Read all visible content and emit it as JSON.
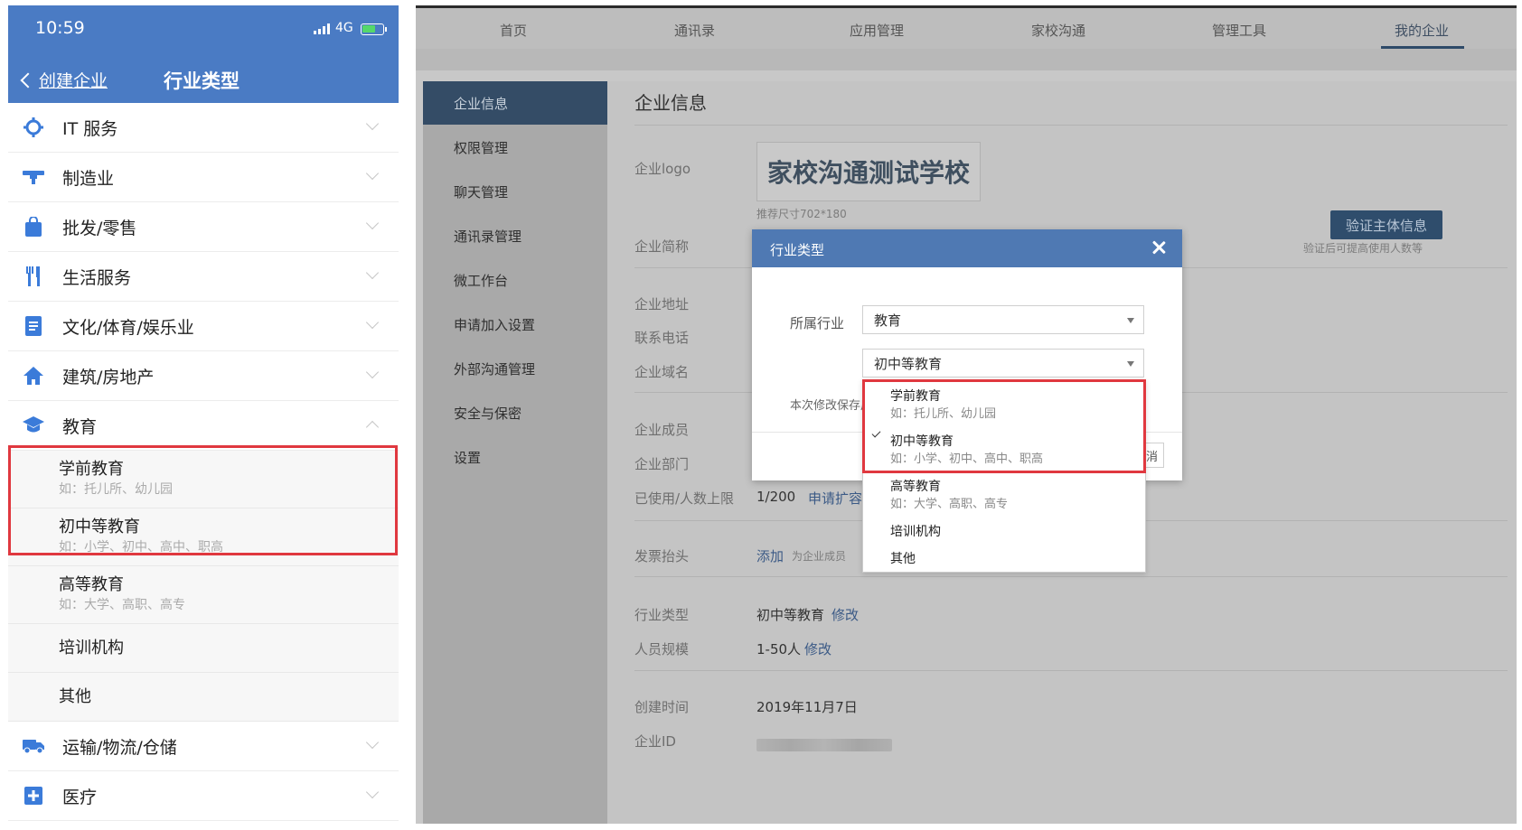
{
  "mobile": {
    "status": {
      "time": "10:59",
      "network": "4G"
    },
    "nav": {
      "back_label": "创建企业",
      "title": "行业类型"
    },
    "categories": [
      {
        "label": "IT 服务",
        "icon": "crosshair-icon",
        "color": "#3b7bd9"
      },
      {
        "label": "制造业",
        "icon": "factory-icon",
        "color": "#3b7bd9"
      },
      {
        "label": "批发/零售",
        "icon": "shopping-bag-icon",
        "color": "#3b7bd9"
      },
      {
        "label": "生活服务",
        "icon": "utensils-icon",
        "color": "#3b7bd9"
      },
      {
        "label": "文化/体育/娱乐业",
        "icon": "document-icon",
        "color": "#3b7bd9"
      },
      {
        "label": "建筑/房地产",
        "icon": "house-icon",
        "color": "#3b7bd9"
      },
      {
        "label": "教育",
        "icon": "graduation-cap-icon",
        "color": "#3b7bd9",
        "expanded": true
      },
      {
        "label": "运输/物流/仓储",
        "icon": "truck-icon",
        "color": "#3b7bd9"
      },
      {
        "label": "医疗",
        "icon": "medical-cross-icon",
        "color": "#3b7bd9"
      }
    ],
    "education_sub": [
      {
        "label": "学前教育",
        "desc": "如：托儿所、幼儿园"
      },
      {
        "label": "初中等教育",
        "desc": "如：小学、初中、高中、职高"
      },
      {
        "label": "高等教育",
        "desc": "如：大学、高职、高专"
      },
      {
        "label": "培训机构",
        "desc": ""
      },
      {
        "label": "其他",
        "desc": ""
      }
    ]
  },
  "web": {
    "topnav": [
      "首页",
      "通讯录",
      "应用管理",
      "家校沟通",
      "管理工具",
      "我的企业"
    ],
    "active_tab": "我的企业",
    "sidebar": [
      "企业信息",
      "权限管理",
      "聊天管理",
      "通讯录管理",
      "微工作台",
      "申请加入设置",
      "外部沟通管理",
      "安全与保密",
      "设置"
    ],
    "active_side": "企业信息",
    "main": {
      "title": "企业信息",
      "logo_label": "企业logo",
      "logo_text": "家校沟通测试学校",
      "logo_hint": "推荐尺寸702*180",
      "verify_button": "验证主体信息",
      "verify_hint": "验证后可提高使用人数等",
      "short_name_label": "企业简称",
      "address_label": "企业地址",
      "phone_label": "联系电话",
      "domain_label": "企业域名",
      "members_label": "企业成员",
      "departments_label": "企业部门",
      "usage_label": "已使用/人数上限",
      "usage_value": "1/200",
      "usage_link": "申请扩容",
      "invoice_label": "发票抬头",
      "invoice_link": "添加",
      "invoice_hint": "为企业成员",
      "industry_label": "行业类型",
      "industry_value": "初中等教育",
      "industry_link": "修改",
      "size_label": "人员规模",
      "size_value": "1-50人",
      "size_link": "修改",
      "created_label": "创建时间",
      "created_value": "2019年11月7日",
      "id_label": "企业ID"
    },
    "modal": {
      "title": "行业类型",
      "industry_label": "所属行业",
      "industry_value": "教育",
      "sub_value": "初中等教育",
      "note_label": "本次修改保存后",
      "foot_btn_fragment": "消"
    },
    "dropdown": [
      {
        "label": "学前教育",
        "desc": "如：托儿所、幼儿园",
        "selected": false
      },
      {
        "label": "初中等教育",
        "desc": "如：小学、初中、高中、职高",
        "selected": true
      },
      {
        "label": "高等教育",
        "desc": "如：大学、高职、高专",
        "selected": false
      },
      {
        "label": "培训机构",
        "desc": "",
        "selected": false
      },
      {
        "label": "其他",
        "desc": "",
        "selected": false
      }
    ],
    "colors": {
      "header": "#4f79b3",
      "highlight": "#e0383f",
      "sidebar_active": "#344c66"
    }
  }
}
